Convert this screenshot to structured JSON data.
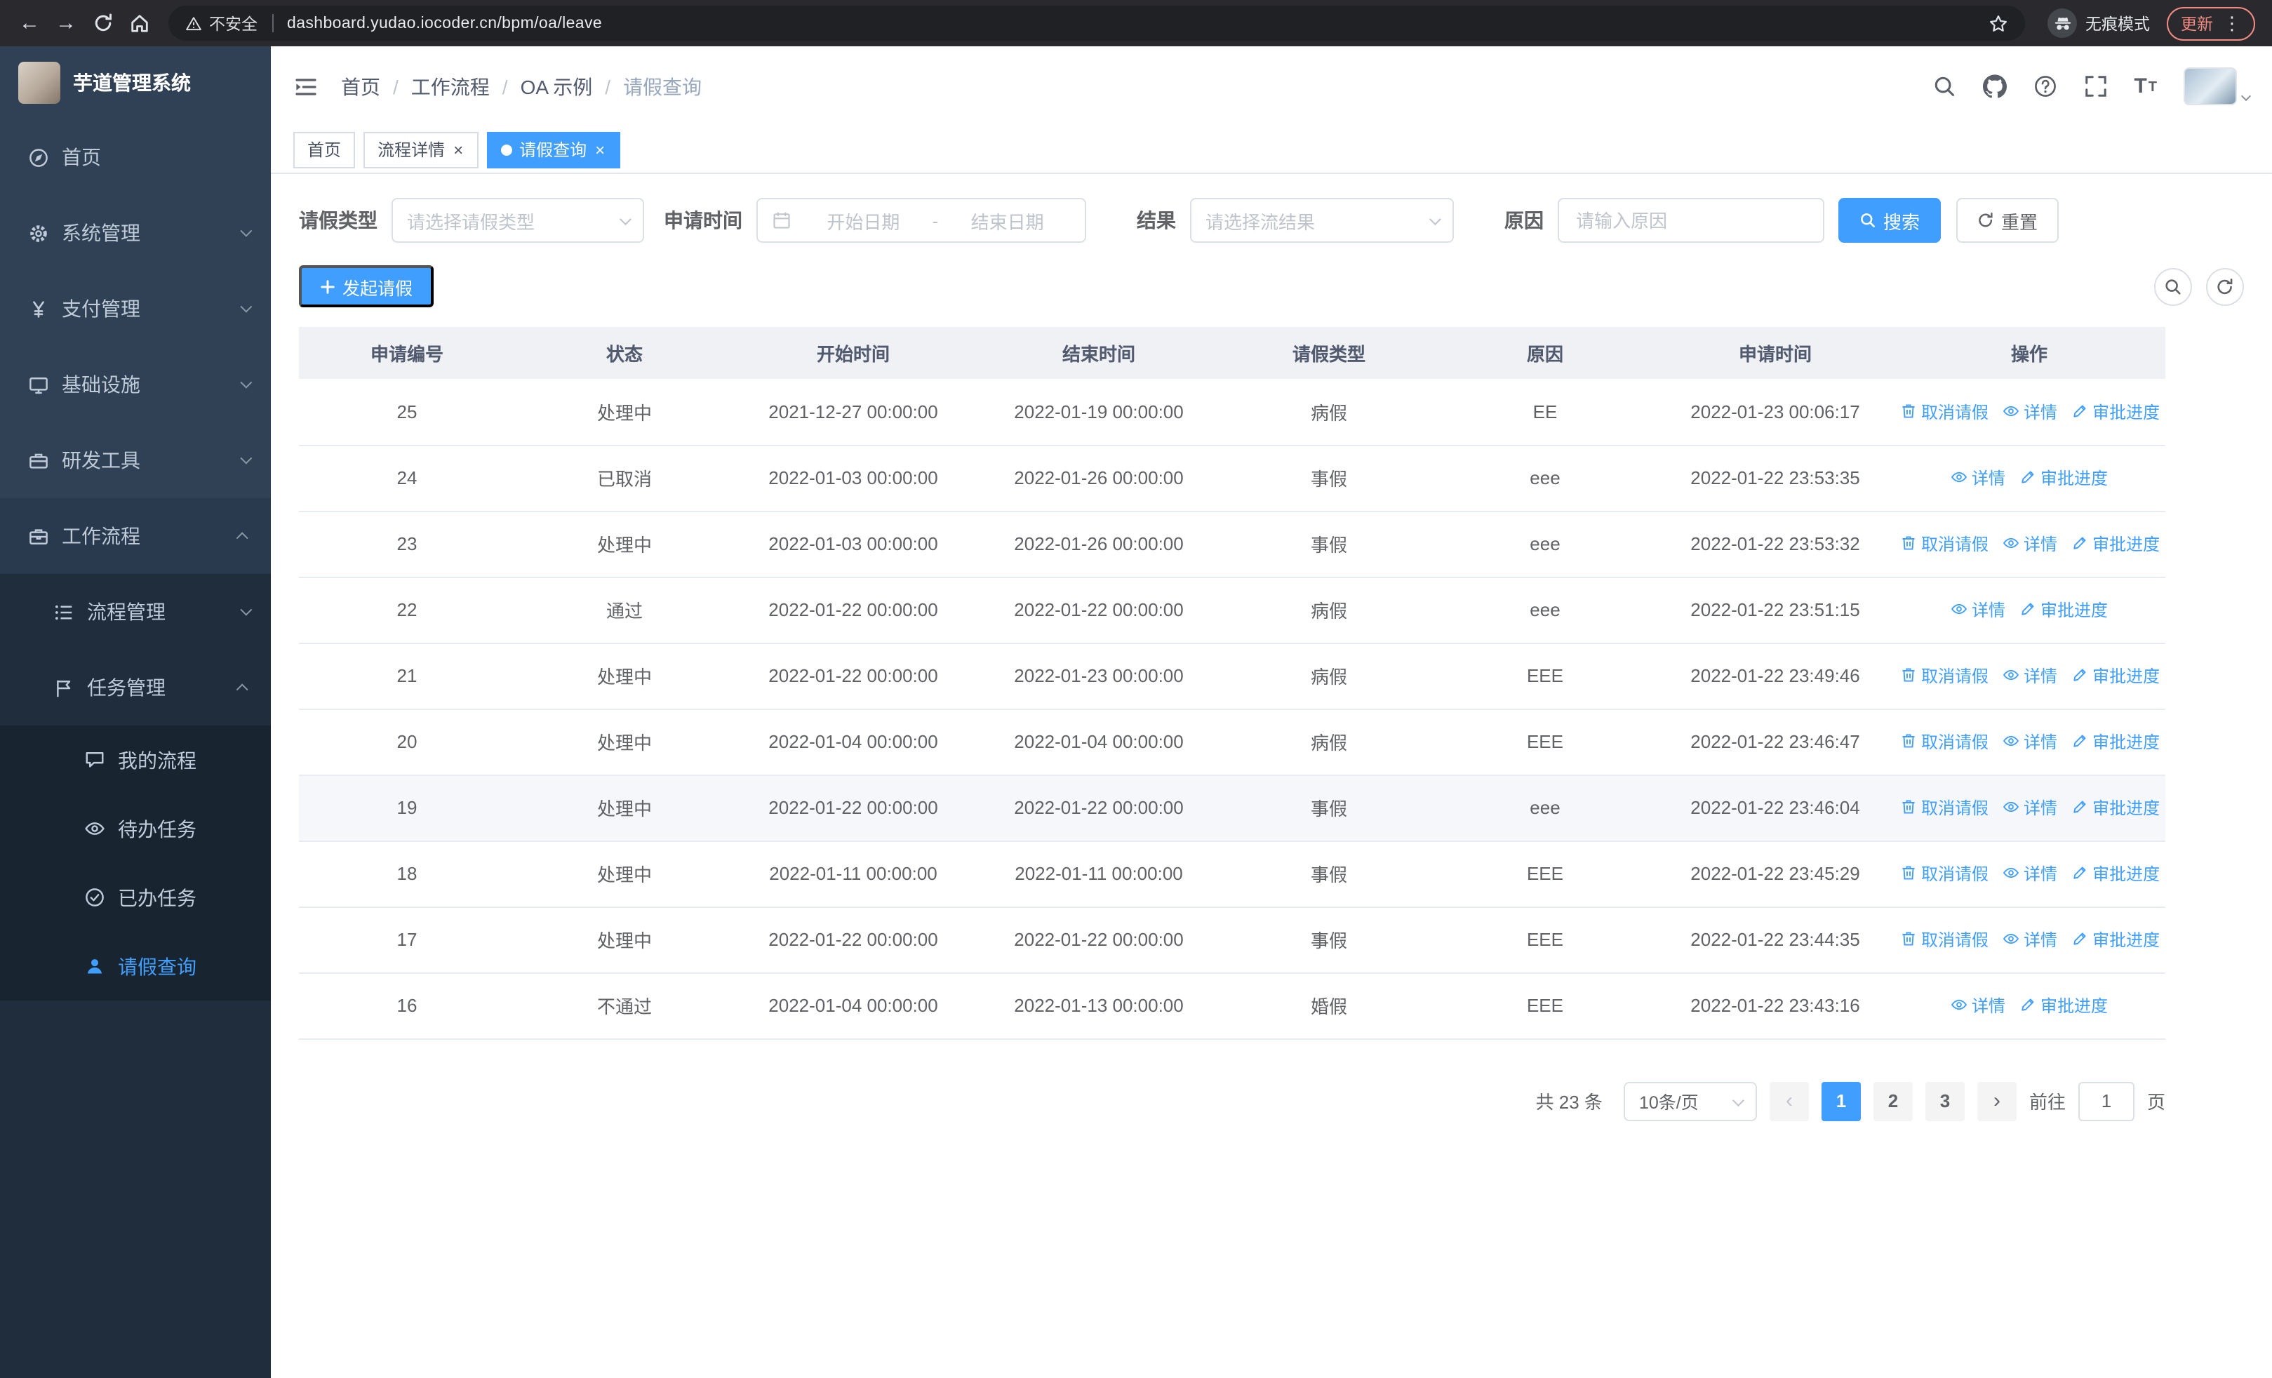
{
  "theme": {
    "accent": "#409eff",
    "sidebar_bg": "#304156",
    "sidebar_submenu_bg": "#1f2d3d"
  },
  "browser": {
    "security_label": "不安全",
    "url": "dashboard.yudao.iocoder.cn/bpm/oa/leave",
    "incognito_label": "无痕模式",
    "update_label": "更新"
  },
  "sidebar": {
    "logo_title": "芋道管理系统",
    "items": [
      {
        "label": "首页",
        "icon": "dashboard-icon"
      },
      {
        "label": "系统管理",
        "icon": "gear-icon"
      },
      {
        "label": "支付管理",
        "icon": "yen-icon"
      },
      {
        "label": "基础设施",
        "icon": "monitor-icon"
      },
      {
        "label": "研发工具",
        "icon": "toolbox-icon"
      },
      {
        "label": "工作流程",
        "icon": "briefcase-icon",
        "expanded": true,
        "children": [
          {
            "label": "流程管理",
            "icon": "flow-list-icon"
          },
          {
            "label": "任务管理",
            "icon": "task-flag-icon",
            "expanded": true,
            "children": [
              {
                "label": "我的流程",
                "icon": "chat-icon"
              },
              {
                "label": "待办任务",
                "icon": "eye-icon"
              },
              {
                "label": "已办任务",
                "icon": "check-icon"
              },
              {
                "label": "请假查询",
                "icon": "user-icon",
                "active": true
              }
            ]
          }
        ]
      }
    ]
  },
  "header": {
    "breadcrumb": [
      "首页",
      "工作流程",
      "OA 示例",
      "请假查询"
    ]
  },
  "tabs": [
    {
      "label": "首页",
      "closable": false,
      "active": false
    },
    {
      "label": "流程详情",
      "closable": true,
      "active": false
    },
    {
      "label": "请假查询",
      "closable": true,
      "active": true
    }
  ],
  "filters": {
    "leave_type_label": "请假类型",
    "leave_type_placeholder": "请选择请假类型",
    "apply_time_label": "申请时间",
    "start_placeholder": "开始日期",
    "range_separator": "-",
    "end_placeholder": "结束日期",
    "result_label": "结果",
    "result_placeholder": "请选择流结果",
    "reason_label": "原因",
    "reason_placeholder": "请输入原因",
    "search_label": "搜索",
    "reset_label": "重置"
  },
  "toolbar": {
    "create_label": "发起请假"
  },
  "table": {
    "columns": [
      "申请编号",
      "状态",
      "开始时间",
      "结束时间",
      "请假类型",
      "原因",
      "申请时间",
      "操作"
    ],
    "action_labels": {
      "cancel": "取消请假",
      "detail": "详情",
      "audit": "审批进度"
    },
    "rows": [
      {
        "id": "25",
        "status": "处理中",
        "start_time": "2021-12-27 00:00:00",
        "end_time": "2022-01-19 00:00:00",
        "leave_type": "病假",
        "reason": "EE",
        "apply_time": "2022-01-23 00:06:17",
        "actions": [
          "cancel",
          "detail",
          "audit"
        ]
      },
      {
        "id": "24",
        "status": "已取消",
        "start_time": "2022-01-03 00:00:00",
        "end_time": "2022-01-26 00:00:00",
        "leave_type": "事假",
        "reason": "eee",
        "apply_time": "2022-01-22 23:53:35",
        "actions": [
          "detail",
          "audit"
        ]
      },
      {
        "id": "23",
        "status": "处理中",
        "start_time": "2022-01-03 00:00:00",
        "end_time": "2022-01-26 00:00:00",
        "leave_type": "事假",
        "reason": "eee",
        "apply_time": "2022-01-22 23:53:32",
        "actions": [
          "cancel",
          "detail",
          "audit"
        ]
      },
      {
        "id": "22",
        "status": "通过",
        "start_time": "2022-01-22 00:00:00",
        "end_time": "2022-01-22 00:00:00",
        "leave_type": "病假",
        "reason": "eee",
        "apply_time": "2022-01-22 23:51:15",
        "actions": [
          "detail",
          "audit"
        ]
      },
      {
        "id": "21",
        "status": "处理中",
        "start_time": "2022-01-22 00:00:00",
        "end_time": "2022-01-23 00:00:00",
        "leave_type": "病假",
        "reason": "EEE",
        "apply_time": "2022-01-22 23:49:46",
        "actions": [
          "cancel",
          "detail",
          "audit"
        ]
      },
      {
        "id": "20",
        "status": "处理中",
        "start_time": "2022-01-04 00:00:00",
        "end_time": "2022-01-04 00:00:00",
        "leave_type": "病假",
        "reason": "EEE",
        "apply_time": "2022-01-22 23:46:47",
        "actions": [
          "cancel",
          "detail",
          "audit"
        ]
      },
      {
        "id": "19",
        "status": "处理中",
        "start_time": "2022-01-22 00:00:00",
        "end_time": "2022-01-22 00:00:00",
        "leave_type": "事假",
        "reason": "eee",
        "apply_time": "2022-01-22 23:46:04",
        "actions": [
          "cancel",
          "detail",
          "audit"
        ],
        "highlight": true
      },
      {
        "id": "18",
        "status": "处理中",
        "start_time": "2022-01-11 00:00:00",
        "end_time": "2022-01-11 00:00:00",
        "leave_type": "事假",
        "reason": "EEE",
        "apply_time": "2022-01-22 23:45:29",
        "actions": [
          "cancel",
          "detail",
          "audit"
        ]
      },
      {
        "id": "17",
        "status": "处理中",
        "start_time": "2022-01-22 00:00:00",
        "end_time": "2022-01-22 00:00:00",
        "leave_type": "事假",
        "reason": "EEE",
        "apply_time": "2022-01-22 23:44:35",
        "actions": [
          "cancel",
          "detail",
          "audit"
        ]
      },
      {
        "id": "16",
        "status": "不通过",
        "start_time": "2022-01-04 00:00:00",
        "end_time": "2022-01-13 00:00:00",
        "leave_type": "婚假",
        "reason": "EEE",
        "apply_time": "2022-01-22 23:43:16",
        "actions": [
          "detail",
          "audit"
        ]
      }
    ]
  },
  "pagination": {
    "total_label": "共 23 条",
    "page_size_label": "10条/页",
    "pages": [
      "1",
      "2",
      "3"
    ],
    "active_page": "1",
    "goto_label": "前往",
    "goto_value": "1",
    "page_unit_label": "页"
  }
}
